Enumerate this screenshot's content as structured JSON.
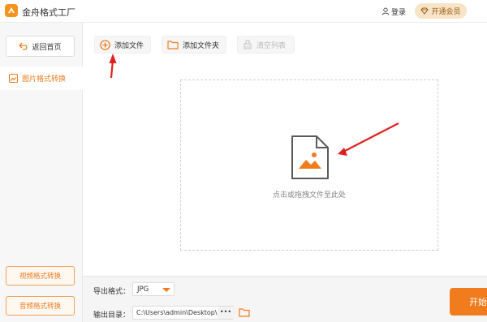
{
  "app": {
    "title": "金舟格式工厂",
    "logo_icon": "app-logo-icon"
  },
  "header": {
    "login_label": "登录",
    "vip_label": "开通会员"
  },
  "sidebar": {
    "back_label": "返回首页",
    "active_item": "图片格式转换",
    "video_label": "视频格式转换",
    "audio_label": "音频格式转换"
  },
  "toolbar": {
    "add_file_label": "添加文件",
    "add_folder_label": "添加文件夹",
    "clear_list_label": "清空列表"
  },
  "dropzone": {
    "hint": "点击或拖拽文件至此处"
  },
  "footer": {
    "format_label": "导出格式：",
    "format_value": "JPG",
    "dir_label": "输出目录：",
    "dir_value": "C:\\Users\\admin\\Desktop\\",
    "more_label": "•••",
    "start_label": "开始"
  },
  "colors": {
    "accent": "#f07c1e",
    "arrow": "#e02020",
    "vip_bg": "#f7e4c6"
  }
}
